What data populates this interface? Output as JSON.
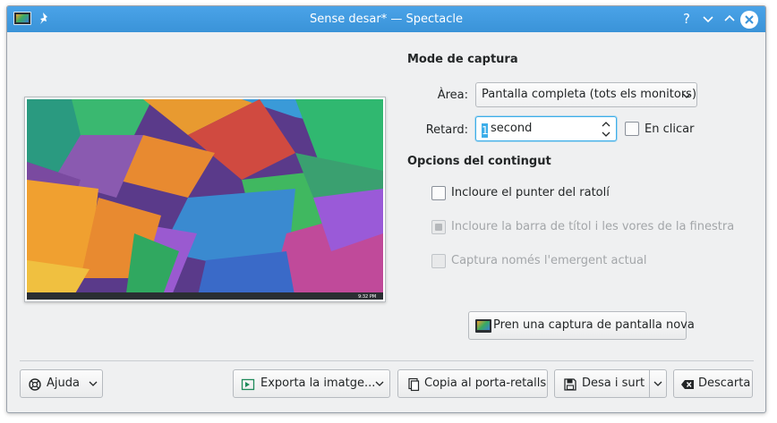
{
  "window": {
    "title": "Sense desar* — Spectacle",
    "help_glyph": "?"
  },
  "capture_mode": {
    "title": "Mode de captura",
    "area_label": "Àrea:",
    "area_value": "Pantalla completa (tots els monitors)",
    "delay_label": "Retard:",
    "delay_cursor": "1",
    "delay_value": "second",
    "on_click_label": "En clicar",
    "on_click_checked": false
  },
  "content_options": {
    "title": "Opcions del contingut",
    "include_pointer_label": "Incloure el punter del ratolí",
    "include_pointer_checked": false,
    "include_titlebar_label": "Incloure la barra de títol i les vores de la finestra",
    "include_titlebar_checked": true,
    "include_titlebar_enabled": false,
    "transient_only_label": "Captura només l'emergent actual",
    "transient_only_checked": false,
    "transient_only_enabled": false
  },
  "new_screenshot_label": "Pren una captura de pantalla nova",
  "footer": {
    "help_label": "Ajuda",
    "export_label": "Exporta la imatge...",
    "copy_label": "Copia al porta-retalls",
    "save_label": "Desa i surt",
    "discard_label": "Descarta"
  },
  "preview": {
    "taskbar_clock": "9:32 PM"
  },
  "icons": {
    "app": "spectacle-icon",
    "pin": "pin-icon",
    "minimize": "chevron-down-icon",
    "maximize": "chevron-up-icon",
    "close": "close-icon",
    "help": "help-icon",
    "export": "export-icon",
    "copy": "copy-icon",
    "save": "save-icon",
    "discard": "discard-icon"
  },
  "colors": {
    "titlebar": "#3d9be3",
    "accent": "#3daee9",
    "window_bg": "#eff0f1"
  }
}
